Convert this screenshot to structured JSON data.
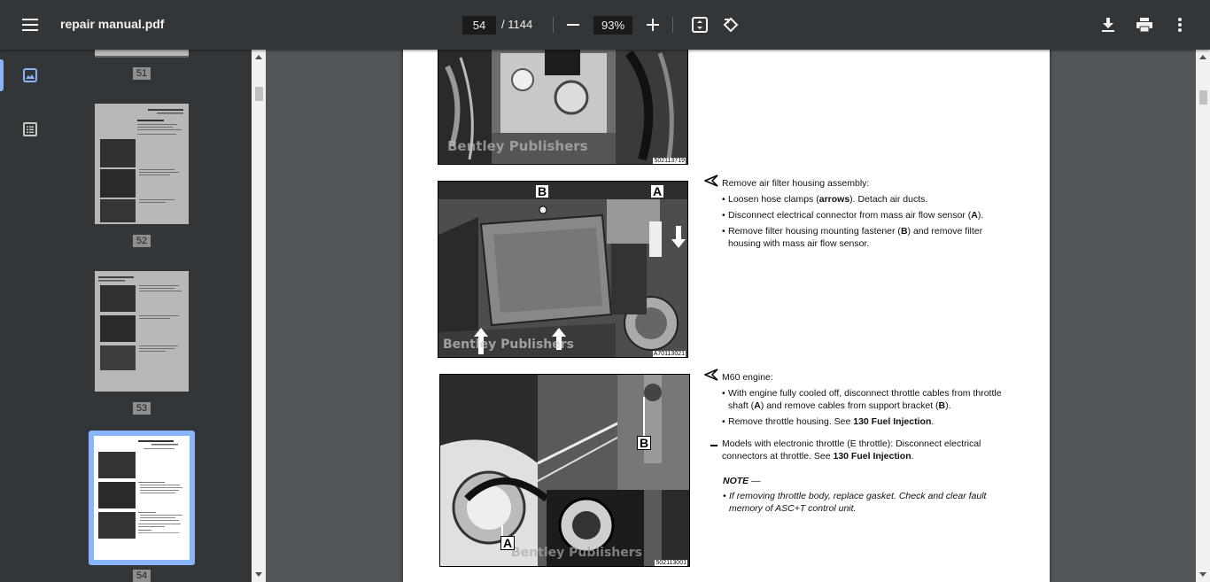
{
  "toolbar": {
    "menu_icon": "menu-icon",
    "title": "repair manual.pdf",
    "page_current": "54",
    "page_total": "/ 1144",
    "zoom": "93%",
    "icons": [
      "zoom-out-icon",
      "zoom-in-icon",
      "fit-page-icon",
      "rotate-icon",
      "download-icon",
      "print-icon",
      "more-vert-icon"
    ]
  },
  "sidenav": {
    "items": [
      {
        "icon": "thumbnails-icon",
        "active": true
      },
      {
        "icon": "outline-icon",
        "active": false
      }
    ]
  },
  "thumbnails": [
    {
      "page": "51"
    },
    {
      "page": "52"
    },
    {
      "page": "53"
    },
    {
      "page": "54",
      "selected": true
    }
  ],
  "document": {
    "photo_ids": [
      "502113719",
      "A70113021",
      "502113001"
    ],
    "section1": {
      "heading": "Remove air filter housing assembly:",
      "bullets": [
        {
          "pre": "Loosen hose clamps (",
          "bold": "arrows",
          "post": "). Detach air ducts."
        },
        {
          "pre": "Disconnect electrical connector from mass air flow sensor (",
          "bold": "A",
          "post": ")."
        },
        {
          "pre": "Remove filter housing mounting fastener (",
          "bold": "B",
          "post": ") and remove filter",
          "line2": "housing with mass air flow sensor."
        }
      ]
    },
    "section2": {
      "heading": "M60 engine:",
      "bullet1": {
        "l1": "With engine fully cooled off, disconnect throttle cables from throttle",
        "l2_pre": "shaft (",
        "l2_b1": "A",
        "l2_mid": ") and remove cables from support bracket (",
        "l2_b2": "B",
        "l2_post": ")."
      },
      "bullet2": {
        "pre": "Remove throttle housing. See ",
        "bold": "130 Fuel Injection",
        "post": "."
      },
      "dash_item": {
        "l1": "Models with electronic throttle (E throttle): Disconnect electrical",
        "l2_pre": "connectors at throttle. See ",
        "l2_bold": "130 Fuel Injection",
        "l2_post": "."
      },
      "note_title": "NOTE",
      "note_suffix": " —",
      "note_l1": "If removing throttle body, replace gasket. Check and clear fault",
      "note_l2": "memory of ASC+T control unit."
    },
    "callouts": {
      "a": "A",
      "b": "B"
    },
    "watermark": "Bentley Publishers"
  }
}
